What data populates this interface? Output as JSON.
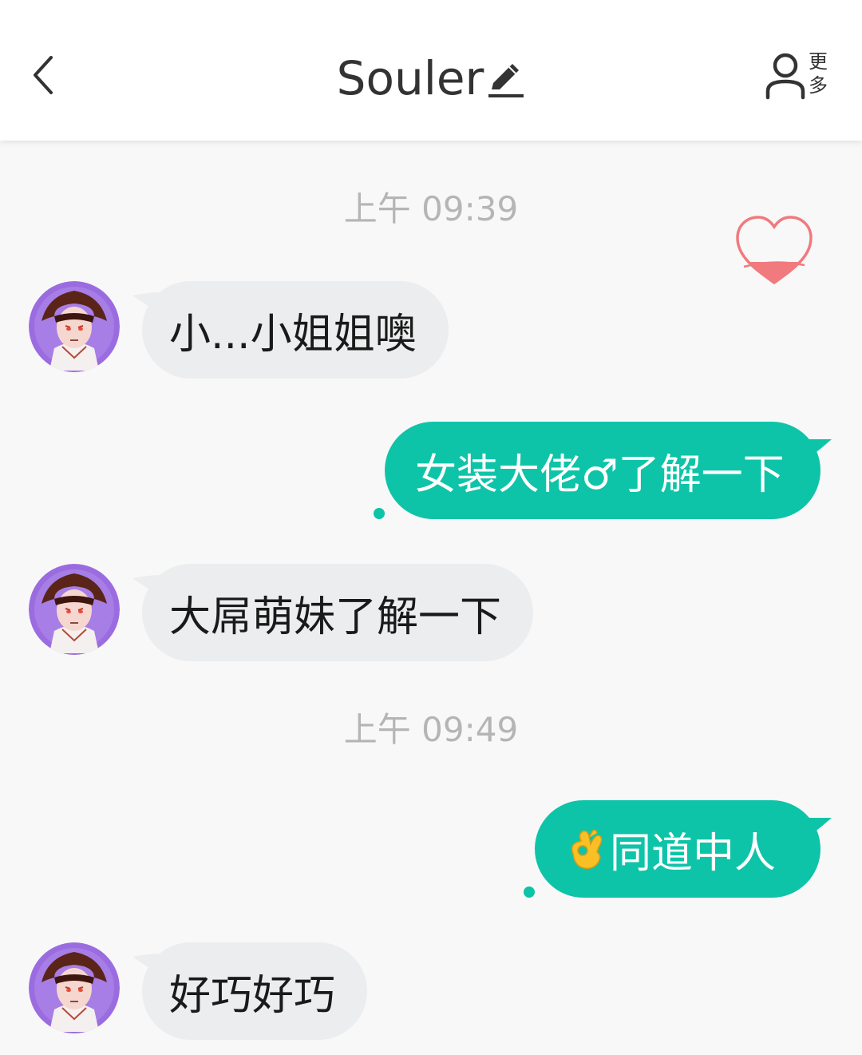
{
  "header": {
    "title": "Souler",
    "back_icon": "chevron-left-icon",
    "edit_icon": "pencil-icon",
    "more_icon": "person-icon",
    "more_label": "更多"
  },
  "colors": {
    "accent": "#0ec4a8",
    "incoming_bubble": "#ebedee",
    "timestamp": "#b5b5b5",
    "heart_stroke": "#f07a7e",
    "avatar_ring": "#9b6ce0"
  },
  "chat": {
    "timestamps": [
      "上午 09:39",
      "上午 09:49"
    ],
    "messages": [
      {
        "direction": "incoming",
        "text": "小...小姐姐噢"
      },
      {
        "direction": "outgoing",
        "text": "女装大佬♂了解一下"
      },
      {
        "direction": "incoming",
        "text": "大屌萌妹了解一下"
      },
      {
        "direction": "outgoing",
        "emoji": "ok-hand-icon",
        "text": "同道中人"
      },
      {
        "direction": "incoming",
        "text": "好巧好巧"
      }
    ]
  }
}
